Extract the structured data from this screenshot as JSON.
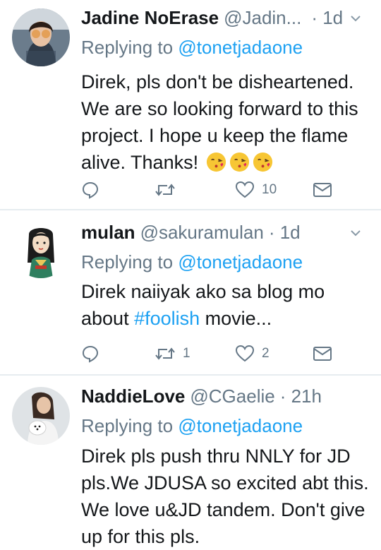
{
  "tweets": [
    {
      "name": "Jadine NoErase",
      "handle": "@Jadin...",
      "time": "· 1d",
      "replying_prefix": "Replying to",
      "replying_handle": "@tonetjadaone",
      "text": "Direk, pls don't be disheartened. We are so looking forward to this project. I hope u keep the flame alive. Thanks!",
      "emojis": [
        "kissing-face-with-heart",
        "kissing-face-with-heart",
        "kissing-face-with-heart"
      ],
      "retweets": "",
      "likes": "10"
    },
    {
      "name": "mulan",
      "handle": "@sakuramulan",
      "time": "· 1d",
      "replying_prefix": "Replying to",
      "replying_handle": "@tonetjadaone",
      "text_before": "Direk naiiyak ako sa blog mo about ",
      "hashtag": "#foolish",
      "text_after": " movie...",
      "retweets": "1",
      "likes": "2"
    },
    {
      "name": "NaddieLove",
      "handle": "@CGaelie",
      "time": "· 21h",
      "replying_prefix": "Replying to",
      "replying_handle": "@tonetjadaone",
      "text": "Direk pls push thru NNLY for JD pls.We JDUSA so excited abt this. We love u&JD tandem. Don't give up for this pls."
    }
  ],
  "colors": {
    "text": "#14171a",
    "secondary": "#657786",
    "link": "#1da1f2",
    "divider": "#e6ecf0"
  }
}
